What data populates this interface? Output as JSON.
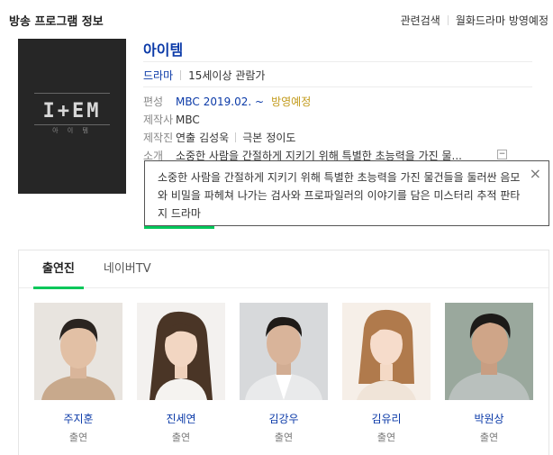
{
  "header": {
    "title": "방송 프로그램 정보",
    "links": [
      "관련검색",
      "월화드라마 방영예정"
    ]
  },
  "poster": {
    "logo_text": "I+EM",
    "logo_sub": "아 이 템"
  },
  "program": {
    "title": "아이템",
    "genre": "드라마",
    "rating": "15세이상 관람가",
    "schedule_label": "편성",
    "channel": "MBC",
    "date": "2019.02. ~",
    "status": "방영예정",
    "producer_label": "제작사",
    "producer": "MBC",
    "crew_label": "제작진",
    "director_role": "연출",
    "director": "김성욱",
    "writer_role": "극본",
    "writer": "정이도",
    "synopsis_label": "소개",
    "synopsis_short": "소중한 사람을 간절하게 지키기 위해 특별한 초능력을 가진 물...",
    "expand_icon": "−"
  },
  "popup": {
    "text": "소중한 사람을 간절하게 지키기 위해 특별한 초능력을 가진 물건들을 둘러싼 음모와 비밀을 파헤쳐 나가는 검사와 프로파일러의 이야기를 담은 미스터리 추적 판타지 드라마",
    "close_icon": "×"
  },
  "tabs": [
    {
      "label": "출연진",
      "active": true
    },
    {
      "label": "네이버TV",
      "active": false
    }
  ],
  "cast": [
    {
      "name": "주지훈",
      "role": "출연"
    },
    {
      "name": "진세연",
      "role": "출연"
    },
    {
      "name": "김강우",
      "role": "출연"
    },
    {
      "name": "김유리",
      "role": "출연"
    },
    {
      "name": "박원상",
      "role": "출연"
    }
  ],
  "colors": {
    "link_blue": "#0b3aa8",
    "naver_green": "#03c75a",
    "status_gold": "#c29a1a"
  }
}
